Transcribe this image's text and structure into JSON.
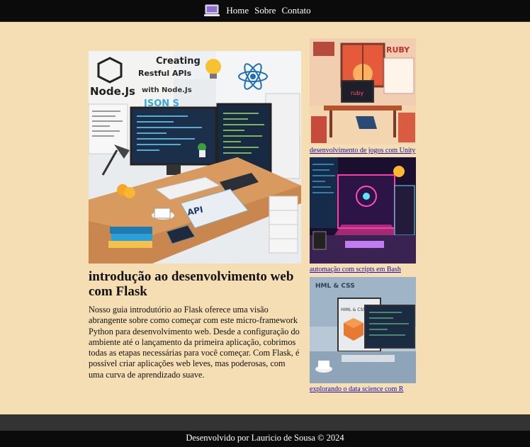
{
  "nav": {
    "logo_icon": "laptop-logo-icon",
    "items": [
      {
        "label": "Home"
      },
      {
        "label": "Sobre"
      },
      {
        "label": "Contato"
      }
    ]
  },
  "featured": {
    "image_icon": "desk-workspace-illustration",
    "title": "introdução ao desenvolvimento web com Flask",
    "description": "Nosso guia introdutório ao Flask oferece uma visão abrangente sobre como começar com este micro-framework Python para desenvolvimento web. Desde a configuração do ambiente até o lançamento da primeira aplicação, cobrimos todas as etapas necessárias para você começar. Com Flask, é possível criar aplicações web leves, mas poderosas, com uma curva de aprendizado suave.",
    "image_text": {
      "node_heading": "Node.Js",
      "creating": "Creating",
      "restful": "Restful APIs",
      "with_node": "with Node.Js",
      "json": "JSON S",
      "api": "API"
    }
  },
  "side_articles": [
    {
      "link": "desenvolvimento de jogos com Unity",
      "image_text": "RUBY",
      "screen_text": "ruby"
    },
    {
      "link": "automação com scripts em Bash",
      "image_text": "",
      "screen_text": ""
    },
    {
      "link": "explorando o data science com R",
      "image_text": "HML & CSS",
      "screen_text": "HIML & CSS"
    }
  ],
  "footer": {
    "text": "Desenvolvido por Lauricio de Sousa © 2024"
  },
  "colors": {
    "page_bg": "#f5deb3",
    "header_bg": "#0b0b0b",
    "footer_top": "#333333",
    "link": "#1a0dab"
  }
}
